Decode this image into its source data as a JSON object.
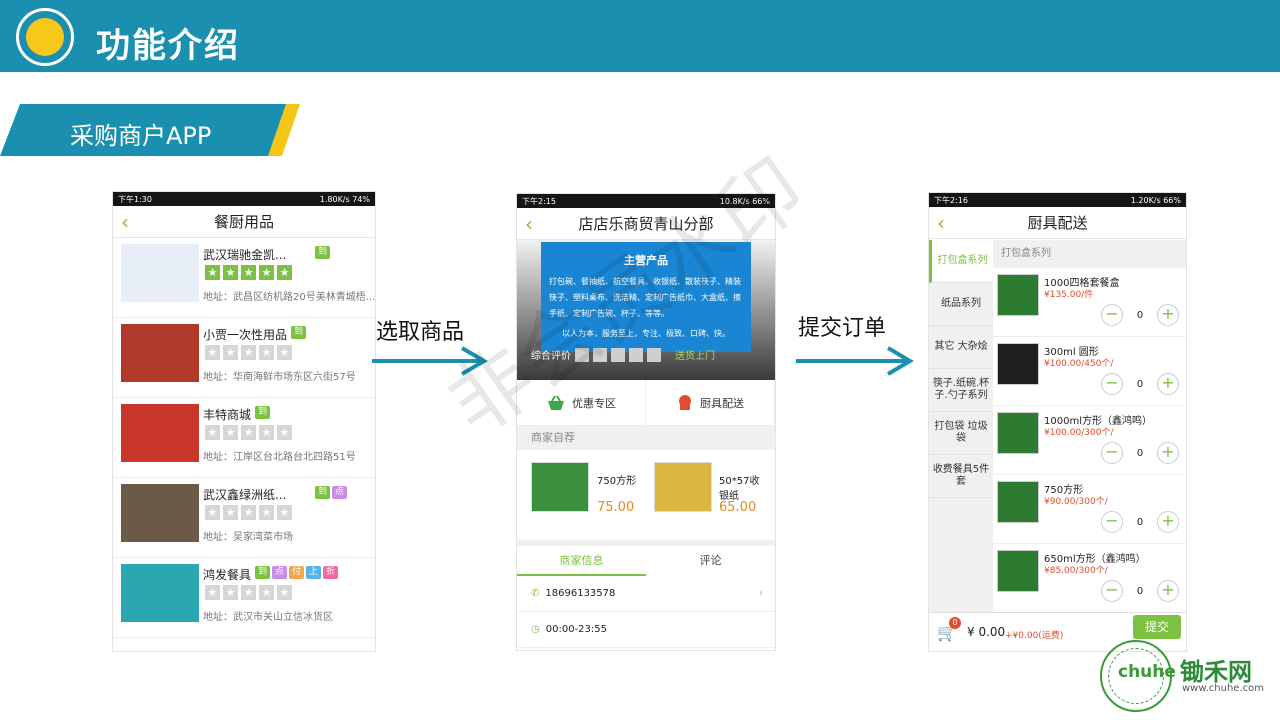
{
  "header": {
    "title": "功能介绍"
  },
  "section": {
    "label": "采购商户APP"
  },
  "arrows": {
    "first": "选取商品",
    "second": "提交订单"
  },
  "watermark": "非会员水印",
  "colors": {
    "brand": "#1b8fb0",
    "accent": "#7cc142",
    "price": "#e8891d"
  },
  "phone1": {
    "status_left": "下午1:30",
    "status_right": "1.80K/s  74%",
    "title": "餐厨用品",
    "shops": [
      {
        "name": "武汉瑞驰金凯...",
        "badges": [
          {
            "t": "到",
            "c": "#7cc142"
          }
        ],
        "stars": 5,
        "addr": "地址：武昌区纺机路20号美林青城梧..."
      },
      {
        "name": "小贾一次性用品",
        "badges": [
          {
            "t": "到",
            "c": "#7cc142"
          }
        ],
        "stars": 0,
        "addr": "地址：华南海鲜市场东区六街57号"
      },
      {
        "name": "丰特商城",
        "badges": [
          {
            "t": "到",
            "c": "#7cc142"
          }
        ],
        "stars": 0,
        "addr": "地址：江岸区台北路台北四路51号"
      },
      {
        "name": "武汉鑫绿洲纸...",
        "badges": [
          {
            "t": "到",
            "c": "#7cc142"
          },
          {
            "t": "点",
            "c": "#c98de8"
          }
        ],
        "stars": 0,
        "addr": "地址：吴家湾菜市场"
      },
      {
        "name": "鸿发餐具",
        "badges": [
          {
            "t": "到",
            "c": "#7cc142"
          },
          {
            "t": "点",
            "c": "#c98de8"
          },
          {
            "t": "付",
            "c": "#f2a64b"
          },
          {
            "t": "上",
            "c": "#5bb2e8"
          },
          {
            "t": "折",
            "c": "#f06aa0"
          }
        ],
        "stars": 0,
        "addr": "地址：武汉市关山立信冰货区"
      }
    ]
  },
  "phone2": {
    "status_left": "下午2:15",
    "status_right": "10.8K/s  66%",
    "title": "店店乐商贸青山分部",
    "board_title": "主营产品",
    "board_text": "打包碗、餐抽纸、航空餐具、收银纸、散装筷子、精装筷子、塑料桌布、洗洁精、定制广告纸巾、大盒纸、擦手纸、定制广告碗、杯子、等等。",
    "board_slogan": "以人为本，服务至上，专注、极致、口碑、快。",
    "rating_label": "综合评价",
    "delivery": "送货上门",
    "tab_discount": "优惠专区",
    "tab_kitchen": "厨具配送",
    "rec_head": "商家自荐",
    "recs": [
      {
        "name": "750方形",
        "price": "75.00"
      },
      {
        "name": "50*57收银纸",
        "price": "65.00"
      }
    ],
    "info_tab_active": "商家信息",
    "info_tab_other": "评论",
    "phone": "18696133578",
    "hours": "00:00-23:55"
  },
  "phone3": {
    "status_left": "下午2:16",
    "status_right": "1.20K/s  66%",
    "title": "厨具配送",
    "categories": [
      "打包盒系列",
      "纸品系列",
      "其它 大杂烩",
      "筷子.纸碗.杯子.勺子系列",
      "打包袋 垃圾袋",
      "收费餐具5件套"
    ],
    "category_head": "打包盒系列",
    "products": [
      {
        "name": "1000四格套餐盒",
        "price": "¥135.00/件",
        "qty": "0"
      },
      {
        "name": "300ml 圆形",
        "price": "¥100.00/450个/",
        "qty": "0"
      },
      {
        "name": "1000ml方形（鑫鸿鸣）",
        "price": "¥100.00/300个/",
        "qty": "0"
      },
      {
        "name": "750方形",
        "price": "¥90.00/300个/",
        "qty": "0"
      },
      {
        "name": "650ml方形（鑫鸿鸣）",
        "price": "¥85.00/300个/",
        "qty": "0"
      }
    ],
    "cart_count": "0",
    "total": "¥ 0.00",
    "freight": "+¥0.00(运费)",
    "submit": "提交"
  },
  "brand": {
    "name": "锄禾网",
    "url": "www.chuhe.com",
    "logo_text": "chuhe"
  }
}
